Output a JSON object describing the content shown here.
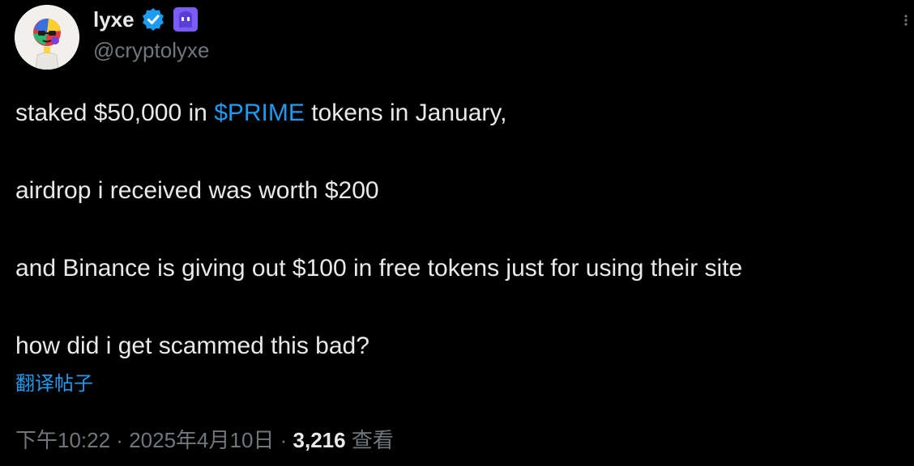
{
  "author": {
    "display_name": "lyxe",
    "handle": "@cryptolyxe",
    "verified": true,
    "avatar_icon": "nft-avatar-icon",
    "badge_icon": "purple-ghost-badge-icon"
  },
  "tweet": {
    "line1_before": "staked $50,000 in ",
    "line1_cashtag": "$PRIME",
    "line1_after": " tokens in January,",
    "line2": "airdrop i received was worth $200",
    "line3": "and Binance is giving out $100 in free tokens just for using their site",
    "line4": "how did i get scammed this bad?"
  },
  "translate_label": "翻译帖子",
  "meta": {
    "time": "下午10:22",
    "sep1": " · ",
    "date": "2025年4月10日",
    "sep2": " · ",
    "views_count": "3,216",
    "views_label": " 查看"
  },
  "colors": {
    "background": "#000000",
    "text": "#e7e9ea",
    "muted": "#71767b",
    "link": "#1d9bf0",
    "badge": "#7b5cf5"
  }
}
